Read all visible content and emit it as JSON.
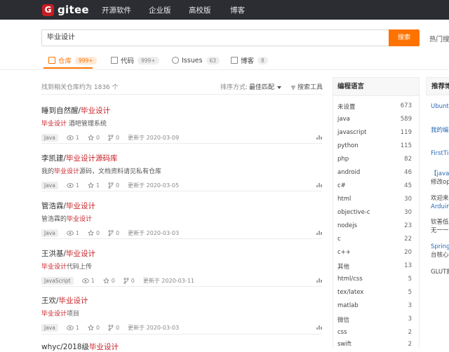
{
  "nav": {
    "logo": "gitee",
    "links": [
      "开源软件",
      "企业版",
      "高校版",
      "博客"
    ]
  },
  "search": {
    "value": "毕业设计",
    "button": "搜索",
    "hot": "热门搜索"
  },
  "tabs": [
    {
      "label": "仓库",
      "count": "999+",
      "active": true
    },
    {
      "label": "代码",
      "count": "999+",
      "active": false
    },
    {
      "label": "Issues",
      "count": "63",
      "active": false
    },
    {
      "label": "博客",
      "count": "8",
      "active": false
    }
  ],
  "results_header": {
    "found": "找到相关仓库约为 1836 个",
    "sort_label": "排序方式:",
    "sort_value": "最佳匹配",
    "tool": "搜索工具"
  },
  "results": [
    {
      "owner": "睡到自然醒/",
      "repo": "毕业设计",
      "desc_hl": "毕业设计",
      "desc": " 酒吧管理系统",
      "lang": "Java",
      "watch": "1",
      "star": "0",
      "fork": "0",
      "updated": "更新于 2020-03-09"
    },
    {
      "owner": "李凯建/",
      "repo": "毕业设计",
      "repo_tail": "源码库",
      "desc_pre": "我的",
      "desc_hl": "毕业设计",
      "desc": "源码，文档资料请见私有仓库",
      "lang": "Java",
      "watch": "1",
      "star": "1",
      "fork": "0",
      "updated": "更新于 2020-03-05"
    },
    {
      "owner": "管浩霖/",
      "repo": "毕业设计",
      "desc_pre": "管浩霖的",
      "desc_hl": "毕业设计",
      "desc": "",
      "lang": "Java",
      "watch": "1",
      "star": "0",
      "fork": "0",
      "updated": "更新于 2020-03-03"
    },
    {
      "owner": "王洪基/",
      "repo": "毕业设计",
      "desc_hl": "毕业设计",
      "desc": "代码上传",
      "lang": "JavaScript",
      "watch": "1",
      "star": "0",
      "fork": "0",
      "updated": "更新于 2020-03-11"
    },
    {
      "owner": "王欢/",
      "repo": "毕业设计",
      "desc_hl": "毕业设计",
      "desc": "项目",
      "lang": "Java",
      "watch": "1",
      "star": "0",
      "fork": "0",
      "updated": "更新于 2020-03-03"
    },
    {
      "owner": "whyc/2018级",
      "repo": "毕业设计"
    }
  ],
  "languages": {
    "title": "编程语言",
    "items": [
      {
        "name": "未设置",
        "count": "673"
      },
      {
        "name": "java",
        "count": "589"
      },
      {
        "name": "javascript",
        "count": "119"
      },
      {
        "name": "python",
        "count": "115"
      },
      {
        "name": "php",
        "count": "82"
      },
      {
        "name": "android",
        "count": "46"
      },
      {
        "name": "c#",
        "count": "45"
      },
      {
        "name": "html",
        "count": "30"
      },
      {
        "name": "objective-c",
        "count": "30"
      },
      {
        "name": "nodejs",
        "count": "23"
      },
      {
        "name": "c",
        "count": "22"
      },
      {
        "name": "c++",
        "count": "20"
      },
      {
        "name": "其他",
        "count": "13"
      },
      {
        "name": "html/css",
        "count": "5"
      },
      {
        "name": "tex/latex",
        "count": "5"
      },
      {
        "name": "matlab",
        "count": "3"
      },
      {
        "name": "微信",
        "count": "3"
      },
      {
        "name": "css",
        "count": "2"
      },
      {
        "name": "swift",
        "count": "2"
      }
    ]
  },
  "recommend": {
    "title": "推荐博客",
    "items": [
      {
        "text": "Ubuntu"
      },
      {
        "text": "我的编"
      },
      {
        "text": "FirstTim"
      },
      {
        "text": "【java"
      },
      {
        "text": "修改op",
        "dark": true
      },
      {
        "text": "欢迎来"
      },
      {
        "text": "Arduino"
      },
      {
        "text": "钦善低"
      },
      {
        "text": "无一一"
      },
      {
        "text": "Spring"
      },
      {
        "text": "台核心"
      },
      {
        "text": "GLUT的"
      }
    ]
  },
  "colors": {
    "accent": "#fe7300",
    "highlight": "#c71d23",
    "nav_bg": "#2b2d33"
  }
}
